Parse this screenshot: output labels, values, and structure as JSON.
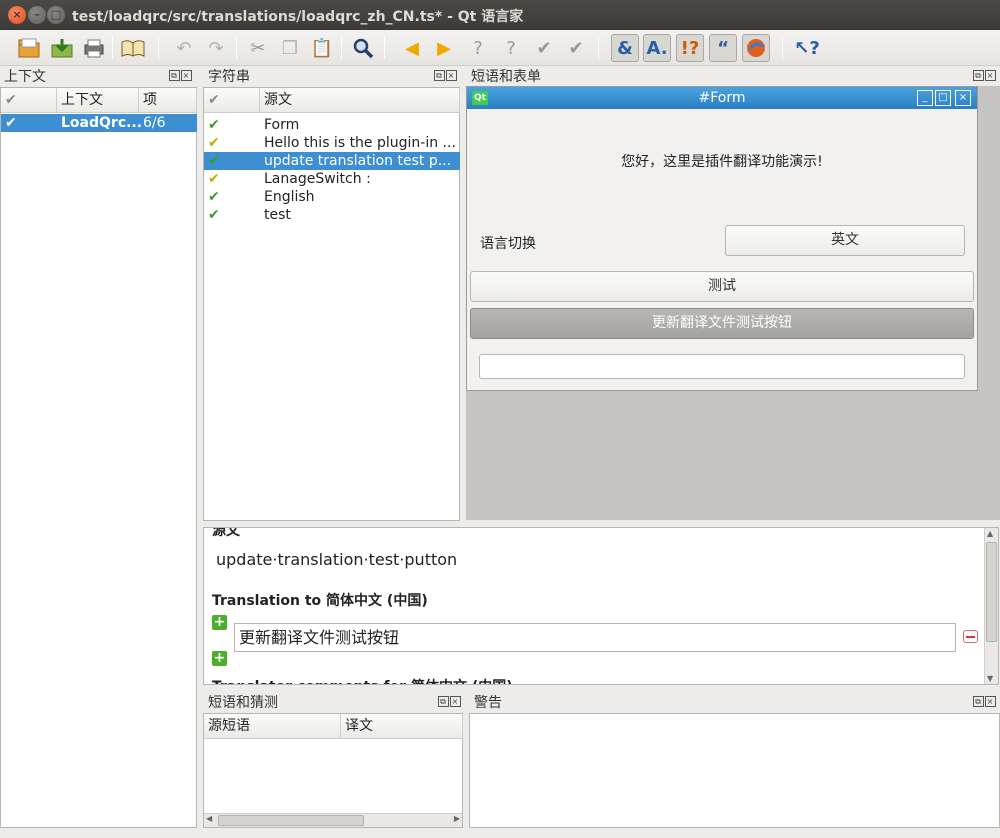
{
  "window": {
    "title": "test/loadqrc/src/translations/loadqrc_zh_CN.ts* - Qt 语言家"
  },
  "toolbar": {
    "icons": [
      "open-icon",
      "save-icon",
      "print-icon",
      "phrasebook-icon",
      "undo-icon",
      "redo-icon",
      "cut-icon",
      "copy-icon",
      "paste-icon",
      "find-icon",
      "prev-icon",
      "next-icon",
      "prev-unfinished-icon",
      "next-unfinished-icon",
      "accept-icon",
      "accept-next-icon",
      "accelerators-icon",
      "punctuation-icon",
      "phrase-matches-icon",
      "placeholders-icon",
      "validation-icon",
      "whats-this-icon"
    ]
  },
  "context_dock": {
    "title": "上下文",
    "headers": {
      "context": "上下文",
      "items": "项"
    },
    "rows": [
      {
        "name": "LoadQrc...",
        "count": "6/6"
      }
    ]
  },
  "strings_dock": {
    "title": "字符串",
    "headers": {
      "source": "源文"
    },
    "rows": [
      {
        "text": "Form",
        "status": "done"
      },
      {
        "text": "Hello this is the plugin-in ...",
        "status": "warn"
      },
      {
        "text": "update translation test p...",
        "status": "done",
        "selected": true
      },
      {
        "text": "LanageSwitch :",
        "status": "warn"
      },
      {
        "text": "English",
        "status": "done"
      },
      {
        "text": "test",
        "status": "done"
      }
    ]
  },
  "phrases_dock": {
    "title": "短语和表单"
  },
  "form": {
    "window_title": "#Form",
    "qt_logo": "Qt",
    "greeting": "您好，这里是插件翻译功能演示!",
    "lang_label": "语言切换",
    "english_btn": "英文",
    "test_btn": "测试",
    "update_btn": "更新翻译文件测试按钮"
  },
  "editor": {
    "source_header": "源文",
    "source_text": "update·translation·test·putton",
    "translation_header": "Translation to 简体中文 (中国)",
    "translation_value": "更新翻译文件测试按钮",
    "comments_header": "Translator comments for 简体中文 (中国)"
  },
  "guess_dock": {
    "title": "短语和猜测",
    "headers": {
      "source_phrase": "源短语",
      "translation": "译文"
    }
  },
  "warnings_dock": {
    "title": "警告"
  }
}
